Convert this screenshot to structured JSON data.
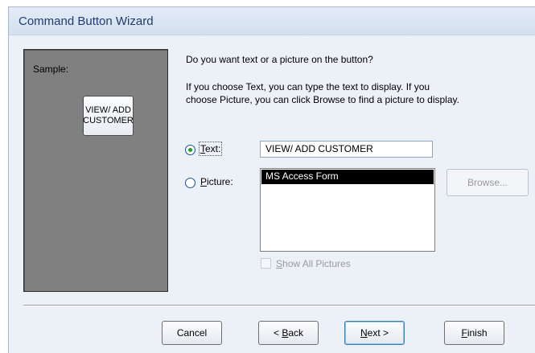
{
  "window": {
    "title": "Command Button Wizard"
  },
  "sample": {
    "label": "Sample:",
    "button_text": "VIEW/ ADD\nCUSTOMER"
  },
  "question": "Do you want text or a picture on the button?",
  "explanation_line1": "If you choose Text, you can type the text to display.  If you",
  "explanation_line2": "choose Picture, you can click Browse to find a picture to display.",
  "options": {
    "text": {
      "mnemonic": "T",
      "rest": "ext:",
      "value": "VIEW/ ADD CUSTOMER",
      "selected": true
    },
    "picture": {
      "mnemonic": "P",
      "rest": "icture:",
      "selected": false
    }
  },
  "picture_list": {
    "items": [
      "MS Access Form"
    ],
    "selected": "MS Access Form"
  },
  "browse_button": {
    "label": "Browse..."
  },
  "show_all_pictures": {
    "mnemonic": "S",
    "rest": "how All Pictures",
    "checked": false
  },
  "buttons": {
    "cancel": "Cancel",
    "back": {
      "pre": "< ",
      "mnemonic": "B",
      "rest": "ack"
    },
    "next": {
      "mnemonic": "N",
      "rest": "ext >"
    },
    "finish": {
      "mnemonic": "F",
      "rest": "inish"
    }
  },
  "colors": {
    "title_text": "#1f3c6d",
    "sample_background": "#808080",
    "radio_dot": "#2b9a2b",
    "selection": "#000000"
  }
}
